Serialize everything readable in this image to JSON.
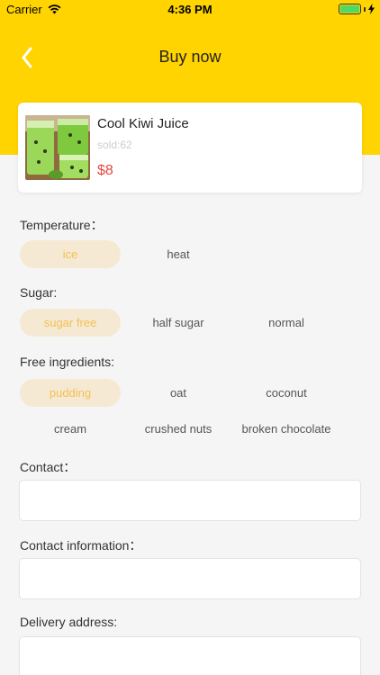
{
  "status_bar": {
    "carrier": "Carrier",
    "time": "4:36 PM",
    "battery_level": 1.0
  },
  "nav": {
    "title": "Buy now",
    "back_icon": "chevron-left-icon"
  },
  "product": {
    "name": "Cool Kiwi Juice",
    "sold": "sold:62",
    "price": "$8"
  },
  "temperature": {
    "label": "Temperature：",
    "options": [
      "ice",
      "heat"
    ],
    "selected": "ice"
  },
  "sugar": {
    "label": "Sugar:",
    "options": [
      "sugar free",
      "half sugar",
      "normal"
    ],
    "selected": "sugar free"
  },
  "ingredients": {
    "label": "Free ingredients:",
    "options": [
      "pudding",
      "oat",
      "coconut",
      "cream",
      "crushed nuts",
      "broken chocolate"
    ],
    "selected": "pudding"
  },
  "contact": {
    "label": "Contact：",
    "value": ""
  },
  "contact_info": {
    "label": "Contact information：",
    "value": ""
  },
  "address": {
    "label": "Delivery address:",
    "value": ""
  },
  "colors": {
    "header": "#ffd400",
    "selected_chip_bg": "#f6e9d3",
    "selected_chip_text": "#f2c053",
    "price": "#e8453c"
  }
}
